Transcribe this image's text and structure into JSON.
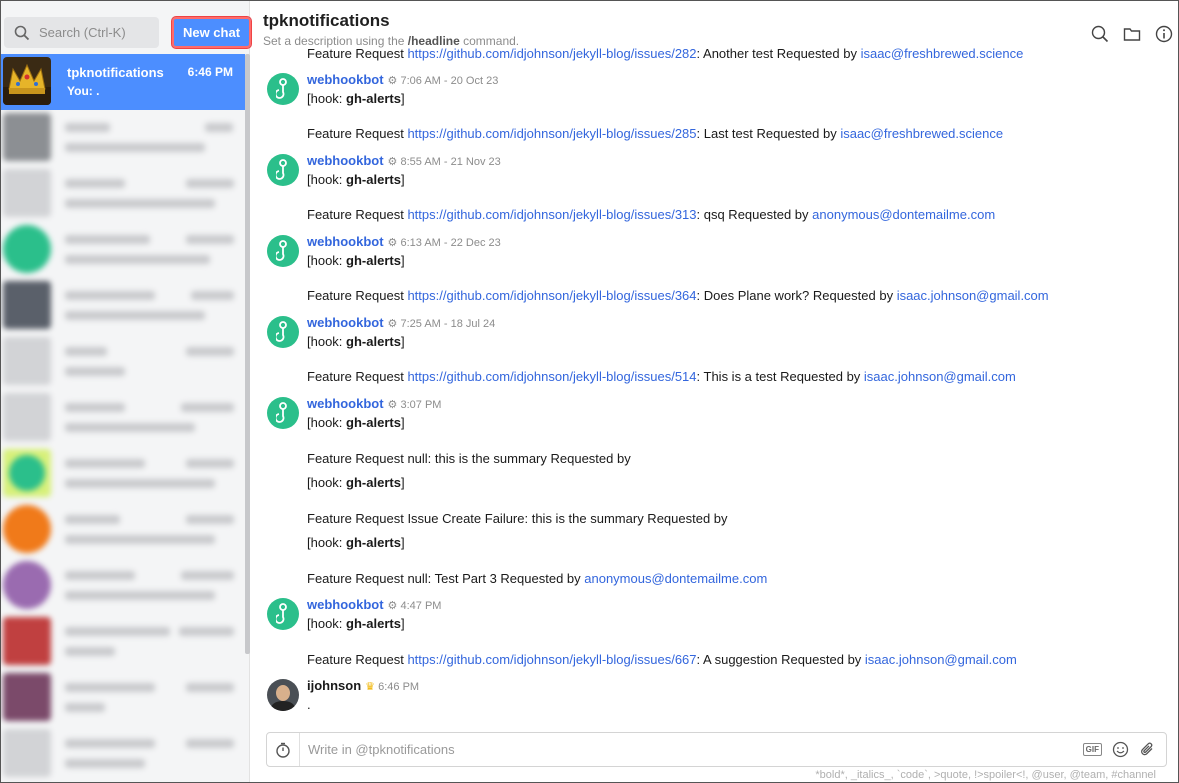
{
  "search": {
    "placeholder": "Search (Ctrl-K)"
  },
  "new_chat_label": "New chat",
  "channel": {
    "name": "tpknotifications",
    "desc_prefix": "Set a description using the ",
    "desc_cmd": "/headline",
    "desc_suffix": " command."
  },
  "active_conv": {
    "name": "tpknotifications",
    "time": "6:46 PM",
    "snippet": "You: ."
  },
  "feed": {
    "top_partial": {
      "text": "Feature Request ",
      "link": "https://github.com/idjohnson/jekyll-blog/issues/282",
      "rest": ": Another test Requested by ",
      "email": "isaac@freshbrewed.science"
    },
    "bot_name": "webhookbot",
    "hook_prefix": "[hook: ",
    "hook_name": "gh-alerts",
    "hook_suffix": "]",
    "meta1": "7:06 AM - 20 Oct 23",
    "req1": {
      "text": "Feature Request ",
      "link": "https://github.com/idjohnson/jekyll-blog/issues/285",
      "rest": ": Last test Requested by ",
      "email": "isaac@freshbrewed.science"
    },
    "meta2": "8:55 AM - 21 Nov 23",
    "req2": {
      "text": "Feature Request ",
      "link": "https://github.com/idjohnson/jekyll-blog/issues/313",
      "rest": ": qsq Requested by ",
      "email": "anonymous@dontemailme.com"
    },
    "meta3": "6:13 AM - 22 Dec 23",
    "req3": {
      "text": "Feature Request ",
      "link": "https://github.com/idjohnson/jekyll-blog/issues/364",
      "rest": ": Does Plane work? Requested by ",
      "email": "isaac.johnson@gmail.com"
    },
    "meta4": "7:25 AM - 18 Jul 24",
    "req4": {
      "text": "Feature Request ",
      "link": "https://github.com/idjohnson/jekyll-blog/issues/514",
      "rest": ": This is a test Requested by ",
      "email": "isaac.johnson@gmail.com"
    },
    "meta5": "3:07 PM",
    "req5": "Feature Request null: this is the summary Requested by",
    "req6": "Feature Request Issue Create Failure: this is the summary Requested by",
    "req7": {
      "text": "Feature Request null: Test Part 3 Requested by ",
      "email": "anonymous@dontemailme.com"
    },
    "meta6": "4:47 PM",
    "req8": {
      "text": "Feature Request ",
      "link": "https://github.com/idjohnson/jekyll-blog/issues/667",
      "rest": ": A suggestion Requested by ",
      "email": "isaac.johnson@gmail.com"
    },
    "user_name": "ijohnson",
    "user_meta": "6:46 PM",
    "user_msg": "."
  },
  "composer": {
    "placeholder": "Write in @tpknotifications",
    "gif": "GIF"
  },
  "hint": "*bold*, _italics_, `code`, >quote, !>spoiler<!, @user, @team, #channel",
  "colors": {
    "accent": "#4c8eff",
    "link": "#3366dd",
    "bot": "#2bbf8b"
  }
}
